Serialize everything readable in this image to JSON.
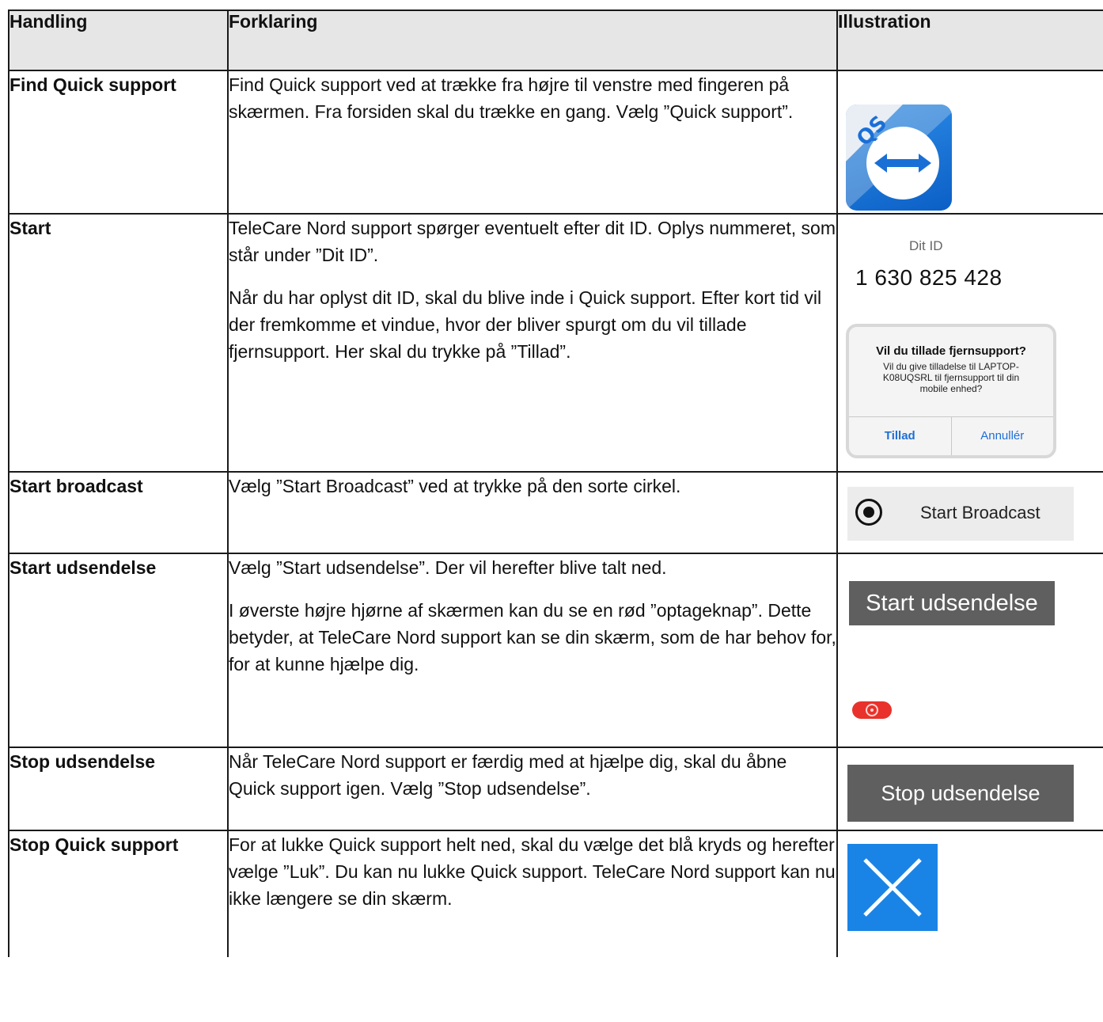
{
  "headers": {
    "action": "Handling",
    "explanation": "Forklaring",
    "illustration": "Illustration"
  },
  "rows": [
    {
      "action": "Find Quick support",
      "paragraphs": [
        "Find Quick support ved at trække fra højre til venstre med fingeren på skærmen. Fra forsiden skal du trække en gang. Vælg ”Quick support”."
      ],
      "icon_text": "QS"
    },
    {
      "action": "Start",
      "paragraphs": [
        "TeleCare Nord support spørger eventuelt efter dit ID. Oplys nummeret, som står under ”Dit ID”.",
        "Når du har oplyst dit ID, skal du blive inde i Quick support. Efter kort tid vil der fremkomme et vindue, hvor der bliver spurgt om du vil tillade fjernsupport. Her skal du trykke på ”Tillad”."
      ],
      "id_label": "Dit ID",
      "id_value": "1 630 825 428",
      "dialog": {
        "title": "Vil du tillade fjernsupport?",
        "body": "Vil du give tilladelse til LAPTOP-K08UQSRL til fjernsupport til din mobile enhed?",
        "allow": "Tillad",
        "cancel": "Annullér"
      }
    },
    {
      "action": "Start broadcast",
      "paragraphs": [
        "Vælg ”Start Broadcast” ved at trykke på den sorte cirkel."
      ],
      "button": "Start Broadcast"
    },
    {
      "action": "Start udsendelse",
      "paragraphs": [
        "Vælg ”Start udsendelse”. Der vil herefter blive talt ned.",
        "I øverste højre hjørne af skærmen kan du se en rød ”optageknap”. Dette betyder, at TeleCare Nord support kan se din skærm, som de har behov for, for at kunne hjælpe dig."
      ],
      "button": "Start udsendelse"
    },
    {
      "action": "Stop udsendelse",
      "paragraphs": [
        "Når TeleCare Nord support er færdig med at hjælpe dig, skal du åbne Quick support igen. Vælg ”Stop udsendelse”."
      ],
      "button": "Stop udsendelse"
    },
    {
      "action": "Stop Quick support",
      "paragraphs": [
        "For at lukke Quick support helt ned, skal du vælge det blå kryds og herefter vælge ”Luk”. Du kan nu lukke Quick support. TeleCare Nord support kan nu ikke længere se din skærm."
      ]
    }
  ],
  "colors": {
    "header_bg": "#e6e6e6",
    "qs_blue": "#1a6fd6",
    "record_red": "#e8322b",
    "gray_button": "#5f5f5f",
    "close_blue": "#1a84e6"
  }
}
